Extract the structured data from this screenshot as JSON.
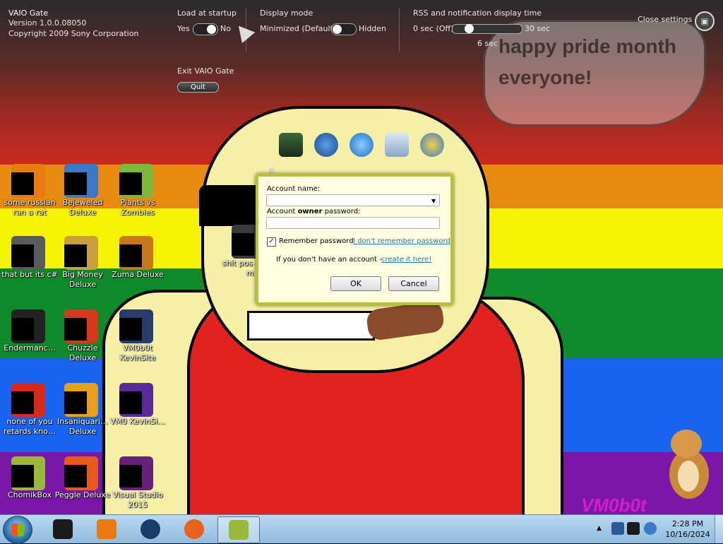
{
  "wallpaper": {
    "speech_bubble_text": "happy pride month everyone!",
    "watermark": "VM0b0t",
    "colors": {
      "red": "#cc2a20",
      "orange": "#e98a10",
      "yellow": "#f6f404",
      "green": "#0f8a2a",
      "blue": "#1a63f0",
      "purple": "#7a17a8"
    }
  },
  "vaio_gate": {
    "title": "VAIO Gate",
    "version": "Version 1.0.0.08050",
    "copyright": "Copyright 2009 Sony Corporation",
    "load_at_startup": {
      "label": "Load at startup",
      "on_label": "Yes",
      "off_label": "No",
      "value": "Yes"
    },
    "display_mode": {
      "label": "Display mode",
      "option_a": "Minimized (Default)",
      "option_b": "Hidden",
      "value": "Minimized (Default)"
    },
    "rss": {
      "label": "RSS and notification display time",
      "min_label": "0 sec (Off)",
      "max_label": "30 sec",
      "current": "6 sec",
      "fraction": 0.2
    },
    "exit": {
      "label": "Exit VAIO Gate",
      "button": "Quit"
    },
    "close_settings": "Close settings"
  },
  "dock": {
    "icons": [
      "vm-icon",
      "network-globe-icon",
      "internet-explorer-icon",
      "email-icon",
      "users-icon"
    ]
  },
  "desktop_icons": [
    {
      "name": "some-russian-ran-a-rat",
      "label": "some russian ran a rat",
      "color": "#e87a10"
    },
    {
      "name": "bejeweled-deluxe",
      "label": "Bejeweled Deluxe",
      "color": "#3a78c8"
    },
    {
      "name": "plants-vs-zombies",
      "label": "Plants vs Zombies",
      "color": "#7cb83a"
    },
    {
      "name": "that-but-its-csharp",
      "label": "that but its c#",
      "color": "#5a5a5a"
    },
    {
      "name": "big-money-deluxe",
      "label": "Big Money Deluxe",
      "color": "#c8a03a"
    },
    {
      "name": "zuma-deluxe",
      "label": "Zuma Deluxe",
      "color": "#c8781a"
    },
    {
      "name": "shit-post",
      "label": "shit pos asked m",
      "color": "#3a3a3a"
    },
    {
      "name": "endermanch",
      "label": "Endermanc…",
      "color": "#222222"
    },
    {
      "name": "chuzzle-deluxe",
      "label": "Chuzzle Deluxe",
      "color": "#d23a1a"
    },
    {
      "name": "vm0b0t-kevinsite",
      "label": "VM0b0t KevinSite",
      "color": "#2a3a6a"
    },
    {
      "name": "none-of-you",
      "label": "none of you retards kno…",
      "color": "#d82a1a"
    },
    {
      "name": "insaniquarium-deluxe",
      "label": "Insaniquari… Deluxe",
      "color": "#e8a01a"
    },
    {
      "name": "vm0-kevinsite",
      "label": "VM0 KevinSi…",
      "color": "#5a2a9a"
    },
    {
      "name": "chomikbox",
      "label": "ChomikBox",
      "color": "#9ab83a"
    },
    {
      "name": "peggle-deluxe",
      "label": "Peggle Deluxe",
      "color": "#e85a1a"
    },
    {
      "name": "visual-studio-2015",
      "label": "Visual Studio 2015",
      "color": "#68217a"
    }
  ],
  "login_dialog": {
    "account_name_label": "Account name:",
    "account_name_value": "",
    "owner_password_label_pre": "Account ",
    "owner_password_label_bold": "owner",
    "owner_password_label_post": " password:",
    "password_value": "",
    "remember_label": "Remember password",
    "remember_checked": true,
    "forgot_link": "I don't remember password",
    "no_account_text": "If you don't have an account - ",
    "create_link": "create it here!",
    "ok_button": "OK",
    "cancel_button": "Cancel"
  },
  "taskbar": {
    "start": "Start",
    "pinned": [
      "media-player-icon",
      "media-center-icon",
      "globe-icon",
      "firefox-icon",
      "chomikbox-icon"
    ],
    "pinned_colors": [
      "#1a1a1a",
      "#e87a10",
      "#1a3a6a",
      "#e8601a",
      "#9ab83a"
    ],
    "clock_time": "2:28 PM",
    "clock_date": "10/16/2024"
  }
}
